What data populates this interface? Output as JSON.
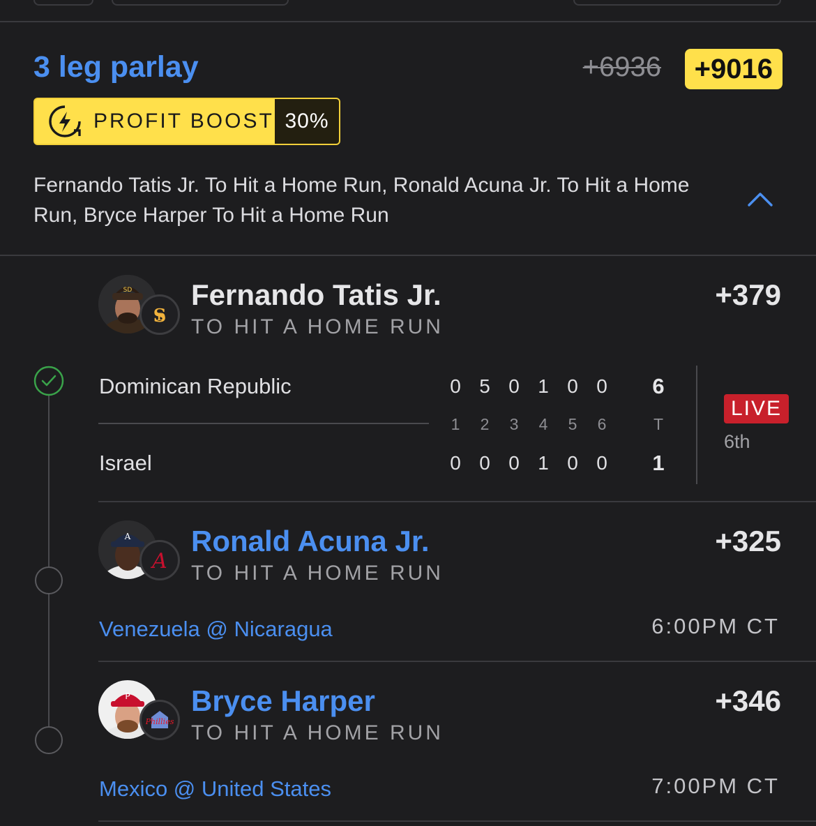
{
  "parlay": {
    "title": "3 leg parlay",
    "old_odds": "+6936",
    "new_odds": "+9016",
    "boost_label": "PROFIT BOOST",
    "boost_pct": "30%",
    "description": "Fernando Tatis Jr. To Hit a Home Run, Ronald Acuna Jr. To Hit a Home Run, Bryce Harper To Hit a Home Run",
    "collapse_icon": "chevron-up-icon"
  },
  "legs": [
    {
      "player": "Fernando Tatis Jr.",
      "market": "TO HIT A HOME RUN",
      "odds": "+379",
      "status_icon": "check-circle-icon",
      "team_logo": "padres-logo",
      "scoreboard": {
        "home_team": "Dominican Republic",
        "away_team": "Israel",
        "home_innings": [
          "0",
          "5",
          "0",
          "1",
          "0",
          "0"
        ],
        "away_innings": [
          "0",
          "0",
          "0",
          "1",
          "0",
          "0"
        ],
        "innings": [
          "1",
          "2",
          "3",
          "4",
          "5",
          "6"
        ],
        "total_label": "T",
        "home_total": "6",
        "away_total": "1",
        "live_label": "LIVE",
        "period": "6th"
      }
    },
    {
      "player": "Ronald Acuna Jr.",
      "market": "TO HIT A HOME RUN",
      "odds": "+325",
      "status_icon": "pending-circle-icon",
      "team_logo": "braves-logo",
      "game": "Venezuela @ Nicaragua",
      "time": "6:00PM CT"
    },
    {
      "player": "Bryce Harper",
      "market": "TO HIT A HOME RUN",
      "odds": "+346",
      "status_icon": "pending-circle-icon",
      "team_logo": "phillies-logo",
      "game": "Mexico @ United States",
      "time": "7:00PM CT"
    }
  ],
  "colors": {
    "background": "#1d1d1f",
    "accent_blue": "#4b8ff0",
    "boost_yellow": "#ffe04b",
    "live_red": "#c8202b",
    "win_green": "#3aa34a"
  }
}
